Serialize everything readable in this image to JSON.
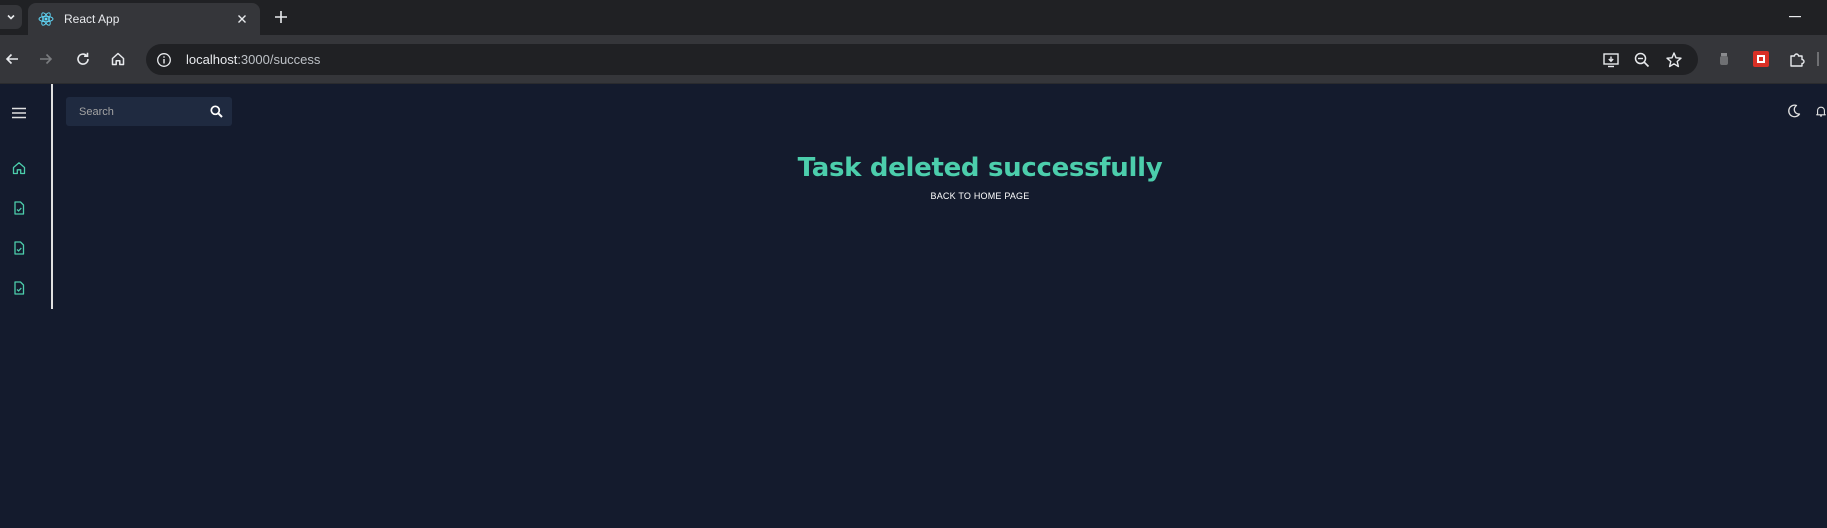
{
  "browser": {
    "tab": {
      "title": "React App"
    },
    "address_bar": {
      "host": "localhost",
      "rest": ":3000/success"
    }
  },
  "app": {
    "search": {
      "placeholder": "Search"
    },
    "message": {
      "title": "Task deleted successfully",
      "back_link": "BACK TO HOME PAGE"
    },
    "sidebar": {
      "icons": [
        "menu-icon",
        "home-icon",
        "task-file-icon",
        "task-file-icon",
        "task-file-icon"
      ]
    },
    "topbar_icons": [
      "dark-mode-moon-icon",
      "notifications-bell-icon"
    ]
  },
  "colors": {
    "accent": "#4cceac",
    "background": "#141b2d",
    "search_bg": "#1f2a40",
    "chrome_dark": "#202124",
    "chrome_toolbar": "#35363a"
  }
}
